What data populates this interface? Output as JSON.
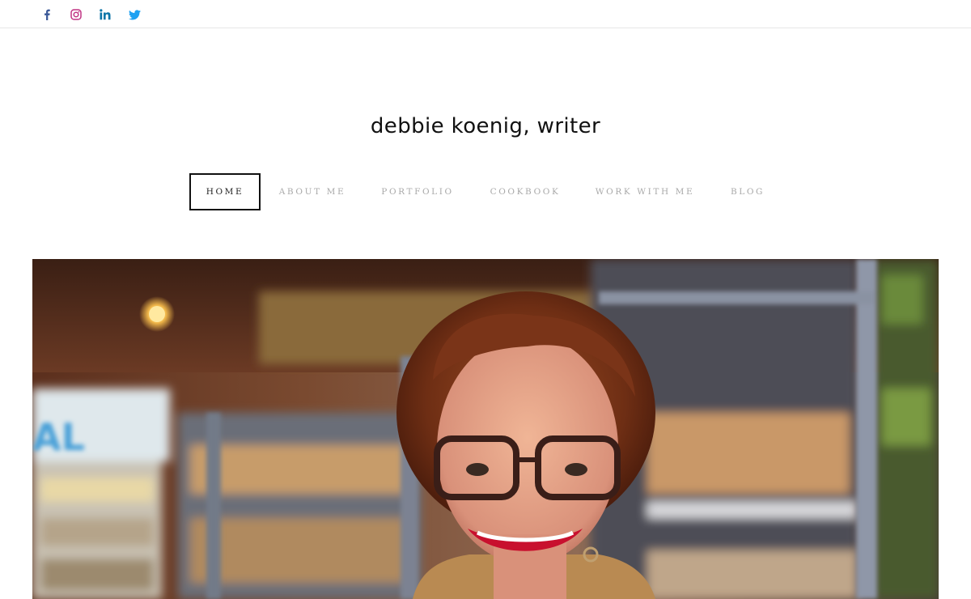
{
  "social": [
    {
      "icon": "facebook-icon",
      "color": "#3b5998"
    },
    {
      "icon": "instagram-icon",
      "color": "#c13584"
    },
    {
      "icon": "linkedin-icon",
      "color": "#0e76a8"
    },
    {
      "icon": "twitter-icon",
      "color": "#1da1f2"
    }
  ],
  "site": {
    "title": "debbie koenig, writer"
  },
  "nav": {
    "items": [
      {
        "label": "HOME",
        "active": true
      },
      {
        "label": "ABOUT ME",
        "active": false
      },
      {
        "label": "PORTFOLIO",
        "active": false
      },
      {
        "label": "COOKBOOK",
        "active": false
      },
      {
        "label": "WORK WITH ME",
        "active": false
      },
      {
        "label": "BLOG",
        "active": false
      }
    ]
  },
  "hero": {
    "sign_text": "AL"
  }
}
